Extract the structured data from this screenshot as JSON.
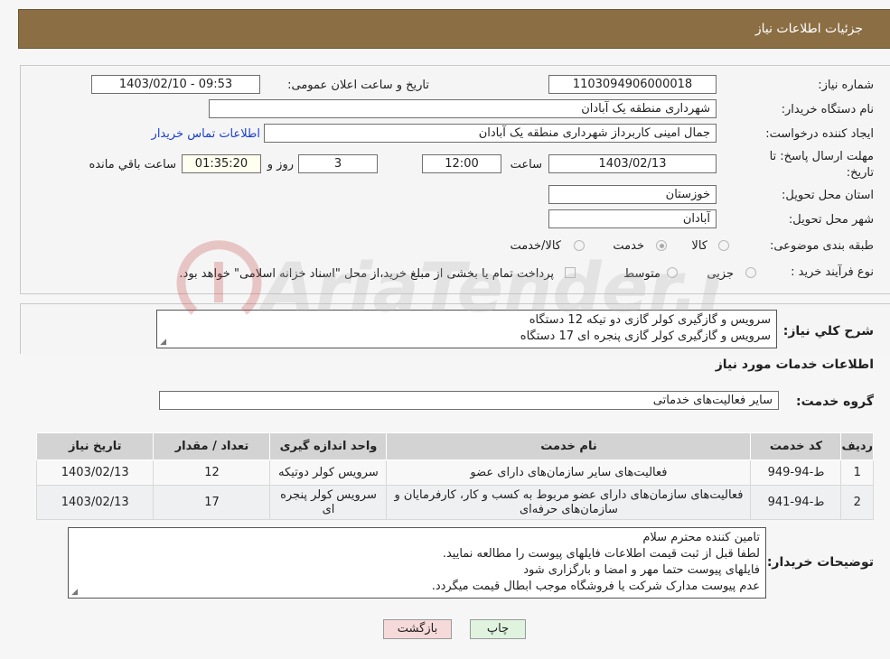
{
  "header": {
    "title": "جزئیات اطلاعات نیاز"
  },
  "form": {
    "need_number_label": "شماره نیاز:",
    "need_number": "1103094906000018",
    "announce_label": "تاریخ و ساعت اعلان عمومی:",
    "announce_value": "1403/02/10 - 09:53",
    "buyer_org_label": "نام دستگاه خریدار:",
    "buyer_org": "شهرداری منطقه یک آبادان",
    "creator_label": "ایجاد کننده درخواست:",
    "creator": "جمال امینی کاربرداز شهرداری منطقه یک آبادان",
    "contact_link": "اطلاعات تماس خریدار",
    "deadline_label": "مهلت ارسال پاسخ: تا تاریخ:",
    "deadline_date": "1403/02/13",
    "time_label": "ساعت",
    "deadline_time": "12:00",
    "days_value": "3",
    "days_label": "روز و",
    "remaining_time": "01:35:20",
    "remaining_label": "ساعت باقي مانده",
    "province_label": "استان محل تحویل:",
    "province": "خوزستان",
    "city_label": "شهر محل تحویل:",
    "city": "آبادان",
    "category_label": "طبقه بندی موضوعی:",
    "category_options": [
      "کالا",
      "خدمت",
      "کالا/خدمت"
    ],
    "category_selected": "خدمت",
    "process_label": "نوع فرآیند خرید :",
    "process_options": [
      "جزیی",
      "متوسط"
    ],
    "payment_note": "پرداخت تمام یا بخشی از مبلغ خرید،از محل \"اسناد خزانه اسلامی\" خواهد بود."
  },
  "description": {
    "label": "شرح کلي نياز:",
    "lines": [
      "سرویس و گازگیری کولر گازی دو تیکه 12 دستگاه",
      "سرویس و گازگیری کولر گازی پنجره ای  17 دستگاه"
    ]
  },
  "services": {
    "section_title": "اطلاعات خدمات مورد نياز",
    "group_label": "گروه خدمت:",
    "group_value": "سایر فعالیت‌های خدماتی",
    "columns": [
      "ردیف",
      "کد خدمت",
      "نام خدمت",
      "واحد اندازه گیری",
      "تعداد / مقدار",
      "تاریخ نیاز"
    ],
    "rows": [
      {
        "idx": "1",
        "code": "ط-94-949",
        "name": "فعالیت‌های سایر سازمان‌های دارای عضو",
        "unit": "سرویس کولر دوتیکه",
        "qty": "12",
        "date": "1403/02/13"
      },
      {
        "idx": "2",
        "code": "ط-94-941",
        "name": "فعالیت‌های سازمان‌های دارای عضو مربوط به کسب و کار، کارفرمایان و سازمان‌های حرفه‌ای",
        "unit": "سرویس کولر پنجره ای",
        "qty": "17",
        "date": "1403/02/13"
      }
    ]
  },
  "buyer_notes": {
    "label": "توضیحات خریدار:",
    "lines": [
      "تامین کننده محترم سلام",
      "لطفا قبل از ثبت قیمت اطلاعات فایلهای پیوست را مطالعه نمایید.",
      "فایلهای پیوست حتما مهر و امضا و بارگزاری شود",
      "عدم پیوست مدارک شرکت یا فروشگاه موجب ابطال قیمت میگردد."
    ]
  },
  "buttons": {
    "print": "چاپ",
    "back": "بازگشت"
  },
  "watermark": {
    "text": "AriaTender.neT"
  },
  "colors": {
    "header_bg": "#8b6e44",
    "back_button_bg": "#f6d9d9",
    "print_button_bg": "#dff3df",
    "link": "#1a3fd1"
  }
}
